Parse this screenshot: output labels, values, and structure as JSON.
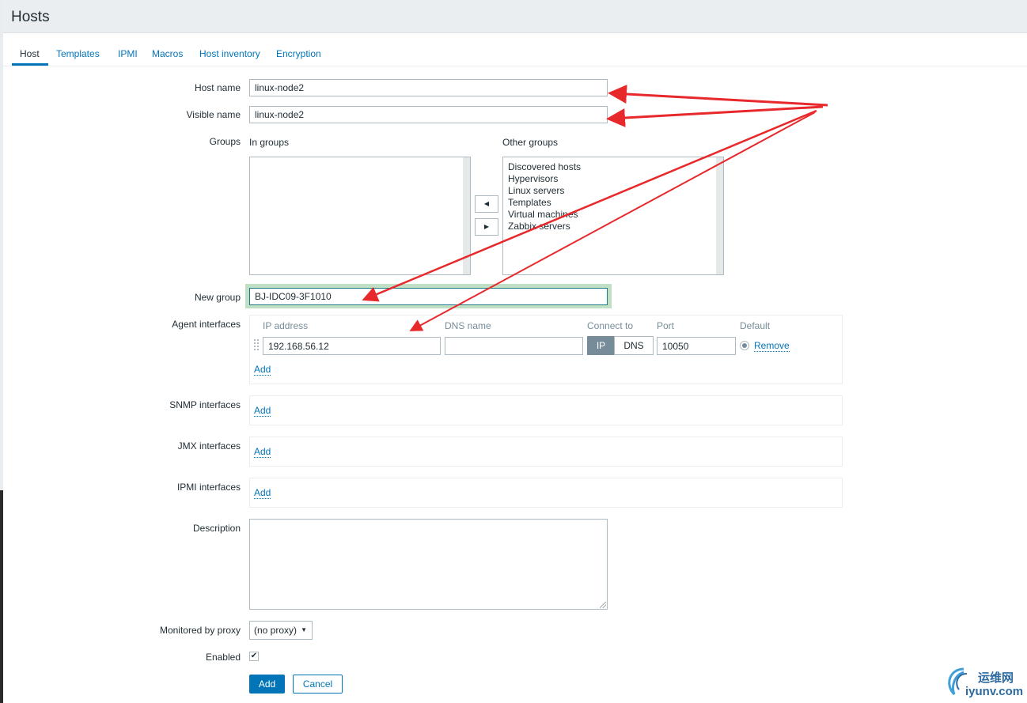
{
  "page": {
    "title": "Hosts"
  },
  "tabs": [
    "Host",
    "Templates",
    "IPMI",
    "Macros",
    "Host inventory",
    "Encryption"
  ],
  "form": {
    "host_name_label": "Host name",
    "host_name_value": "linux-node2",
    "visible_name_label": "Visible name",
    "visible_name_value": "linux-node2",
    "groups_label": "Groups",
    "in_groups_label": "In groups",
    "other_groups_label": "Other groups",
    "other_groups": [
      "Discovered hosts",
      "Hypervisors",
      "Linux servers",
      "Templates",
      "Virtual machines",
      "Zabbix servers"
    ],
    "move_left": "◀",
    "move_right": "▶",
    "new_group_label": "New group",
    "new_group_value": "BJ-IDC09-3F1010",
    "agent_interfaces_label": "Agent interfaces",
    "agent_columns": {
      "ip": "IP address",
      "dns": "DNS name",
      "connect": "Connect to",
      "port": "Port",
      "default": "Default"
    },
    "agent_row": {
      "ip": "192.168.56.12",
      "dns": "",
      "connect_ip": "IP",
      "connect_dns": "DNS",
      "port": "10050",
      "remove": "Remove"
    },
    "add_link": "Add",
    "snmp_interfaces_label": "SNMP interfaces",
    "jmx_interfaces_label": "JMX interfaces",
    "ipmi_interfaces_label": "IPMI interfaces",
    "description_label": "Description",
    "proxy_label": "Monitored by proxy",
    "proxy_value": "(no proxy)",
    "enabled_label": "Enabled",
    "enabled_check": "✔",
    "add_button": "Add",
    "cancel_button": "Cancel"
  },
  "watermark": {
    "chinese": "运维网",
    "domain": "iyunv.com"
  },
  "colors": {
    "accent": "#0275b8",
    "annotation_arrow": "#e8292c",
    "focus_ring": "#bfe0c5"
  }
}
